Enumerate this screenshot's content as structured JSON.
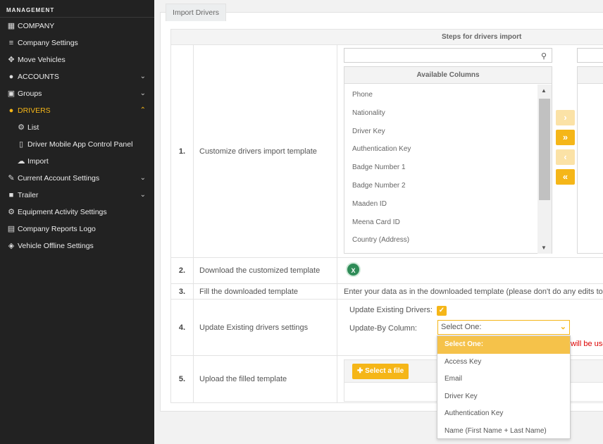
{
  "sidebar": {
    "heading": "MANAGEMENT",
    "items": [
      {
        "label": "COMPANY",
        "icon": "building-icon"
      },
      {
        "label": "Company Settings",
        "icon": "bars-icon"
      },
      {
        "label": "Move Vehicles",
        "icon": "arrows-icon"
      },
      {
        "label": "ACCOUNTS",
        "icon": "users-icon"
      },
      {
        "label": "Groups",
        "icon": "groups-icon"
      },
      {
        "label": "DRIVERS",
        "icon": "users-icon"
      },
      {
        "label": "List",
        "icon": "gear-icon"
      },
      {
        "label": "Driver Mobile App Control Panel",
        "icon": "mobile-icon"
      },
      {
        "label": "Import",
        "icon": "cloud-upload-icon"
      },
      {
        "label": "Current Account Settings",
        "icon": "wrench-icon"
      },
      {
        "label": "Trailer",
        "icon": "trailer-icon"
      },
      {
        "label": "Equipment Activity Settings",
        "icon": "gears-icon"
      },
      {
        "label": "Company Reports Logo",
        "icon": "image-icon"
      },
      {
        "label": "Vehicle Offline Settings",
        "icon": "eye-slash-icon"
      }
    ]
  },
  "tab": {
    "label": "Import Drivers"
  },
  "steps": {
    "header": "Steps for drivers import",
    "rows": [
      {
        "num": "1.",
        "label": "Customize drivers import template"
      },
      {
        "num": "2.",
        "label": "Download the customized template"
      },
      {
        "num": "3.",
        "label": "Fill the downloaded template"
      },
      {
        "num": "4.",
        "label": "Update Existing drivers settings"
      },
      {
        "num": "5.",
        "label": "Upload the filled template"
      }
    ]
  },
  "columns": {
    "header": "Available Columns",
    "items": [
      "Phone",
      "Nationality",
      "Driver Key",
      "Authentication Key",
      "Badge Number 1",
      "Badge Number 2",
      "Maaden ID",
      "Meena Card ID",
      "Country (Address)"
    ]
  },
  "fill_note": "Enter your data as in the downloaded template (please don't do any edits to temp",
  "update": {
    "existing_label": "Update Existing Drivers:",
    "by_label": "Update-By Column:",
    "selected": "Select One:",
    "warning": "will be used"
  },
  "upload": {
    "button": "Select a file"
  },
  "dropdown": {
    "options": [
      "Select One:",
      "Access Key",
      "Email",
      "Driver Key",
      "Authentication Key",
      "Name (First Name + Last Name)"
    ]
  },
  "colors": {
    "accent": "#f5b618",
    "sidebar_bg": "#222222"
  }
}
